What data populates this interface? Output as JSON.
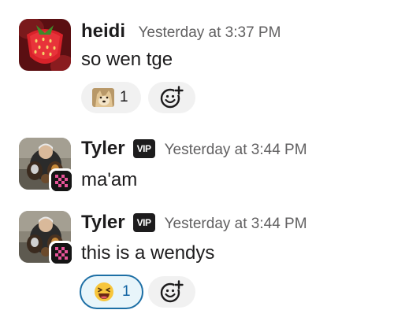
{
  "messages": [
    {
      "author": "heidi",
      "timestamp": "Yesterday at 3:37 PM",
      "text": "so wen tge",
      "vip": "",
      "reaction": {
        "emoji_icon": "doge-emoji-icon",
        "count": "1",
        "active": false
      }
    },
    {
      "author": "Tyler",
      "timestamp": "Yesterday at 3:44 PM",
      "text": "ma'am",
      "vip": "VIP"
    },
    {
      "author": "Tyler",
      "timestamp": "Yesterday at 3:44 PM",
      "text": "this is a wendys",
      "vip": "VIP",
      "reaction": {
        "emoji_icon": "laughing-face-emoji-icon",
        "count": "1",
        "active": true
      }
    }
  ],
  "colors": {
    "text": "#1d1c1d",
    "timestamp": "#616061",
    "pill_bg": "#f1f1f1",
    "active_pill_border": "#1d6fa5",
    "active_pill_bg": "#e8f5fa",
    "active_count": "#1264a3",
    "vip_bg": "#1d1c1d"
  }
}
